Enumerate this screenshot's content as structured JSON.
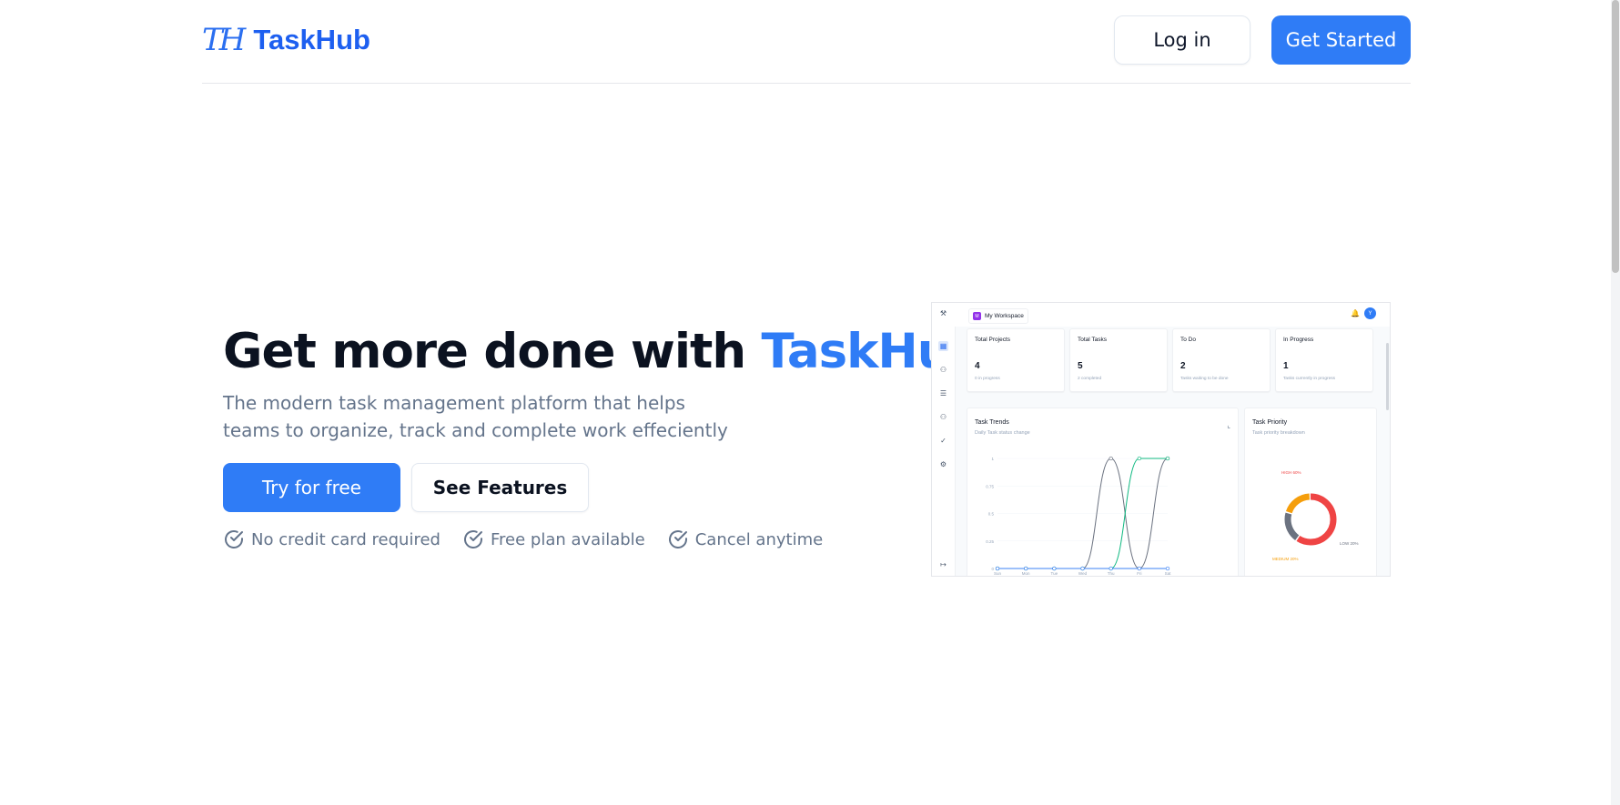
{
  "nav": {
    "logo_mark": "TH",
    "logo_text": "TaskHub",
    "login_label": "Log in",
    "get_started_label": "Get Started"
  },
  "hero": {
    "title_prefix": "Get more done with ",
    "title_accent": "TaskHub",
    "subtitle": "The modern task management platform that helps teams to organize, track and complete work effeciently",
    "try_label": "Try for free",
    "features_label": "See Features",
    "checks": [
      "No credit card required",
      "Free plan available",
      "Cancel anytime"
    ]
  },
  "preview": {
    "workspace_badge": "M",
    "workspace_name": "My Workspace",
    "avatar": "Y",
    "cards": [
      {
        "title": "Total Projects",
        "value": "4",
        "sub": "0 in progress"
      },
      {
        "title": "Total Tasks",
        "value": "5",
        "sub": "2 completed"
      },
      {
        "title": "To Do",
        "value": "2",
        "sub": "Tasks waiting to be done"
      },
      {
        "title": "In Progress",
        "value": "1",
        "sub": "Tasks currently in progress"
      }
    ],
    "trends": {
      "title": "Task Trends",
      "subtitle": "Daily Task status change",
      "y_ticks": [
        "1",
        "0.75",
        "0.5",
        "0.25",
        "0"
      ],
      "x_ticks": [
        "Sun",
        "Mon",
        "Tue",
        "Wed",
        "Thu",
        "Fri",
        "Sat"
      ],
      "series": [
        {
          "color": "#6b7280",
          "values": [
            0,
            0,
            0,
            0,
            1,
            0,
            1
          ]
        },
        {
          "color": "#10b981",
          "values": [
            0,
            0,
            0,
            0,
            0,
            1,
            1
          ]
        },
        {
          "color": "#3b82f6",
          "values": [
            0,
            0,
            0,
            0,
            0,
            0,
            0
          ]
        }
      ]
    },
    "priority": {
      "title": "Task Priority",
      "subtitle": "Task priority breakdown",
      "slices": [
        {
          "label": "HIGH 60%",
          "value": 60,
          "color": "#ef4444"
        },
        {
          "label": "LOW 20%",
          "value": 20,
          "color": "#6b7280"
        },
        {
          "label": "MEDIUM 20%",
          "value": 20,
          "color": "#f59e0b"
        }
      ]
    }
  },
  "colors": {
    "accent": "#2f7cf6",
    "brand": "#1d5ff0"
  }
}
